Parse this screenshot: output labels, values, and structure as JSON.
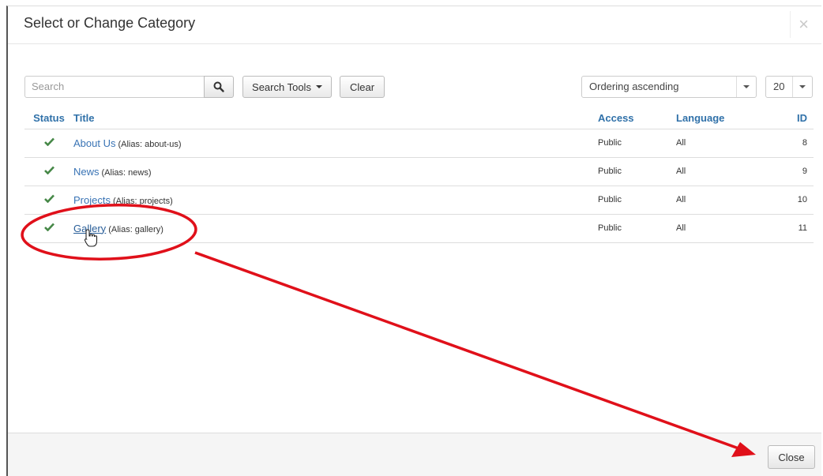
{
  "modal": {
    "title": "Select or Change Category",
    "close_glyph": "×"
  },
  "toolbar": {
    "search_placeholder": "Search",
    "search_tools_label": "Search Tools",
    "clear_label": "Clear",
    "ordering_value": "Ordering ascending",
    "limit_value": "20"
  },
  "table": {
    "headers": {
      "status": "Status",
      "title": "Title",
      "access": "Access",
      "language": "Language",
      "id": "ID"
    },
    "rows": [
      {
        "title": "About Us",
        "alias": "(Alias: about-us)",
        "access": "Public",
        "language": "All",
        "id": "8"
      },
      {
        "title": "News",
        "alias": "(Alias: news)",
        "access": "Public",
        "language": "All",
        "id": "9"
      },
      {
        "title": "Projects",
        "alias": "(Alias: projects)",
        "access": "Public",
        "language": "All",
        "id": "10"
      },
      {
        "title": "Gallery",
        "alias": "(Alias: gallery)",
        "access": "Public",
        "language": "All",
        "id": "11"
      }
    ]
  },
  "footer": {
    "close_label": "Close"
  },
  "icons": {
    "status": "check-icon",
    "search": "search-icon",
    "cursor": "hand-pointer-icon"
  },
  "colors": {
    "link": "#3a74b5",
    "header_text": "#3071a9",
    "check": "#468847",
    "annotation": "#e0101a"
  }
}
